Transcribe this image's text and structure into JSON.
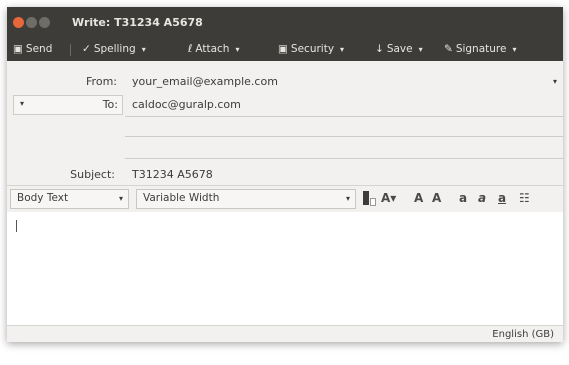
{
  "window": {
    "title": "Write: T31234  A5678"
  },
  "toolbar": {
    "send": "Send",
    "spelling": "Spelling",
    "attach": "Attach",
    "security": "Security",
    "save": "Save",
    "signature": "Signature"
  },
  "header": {
    "from_label": "From:",
    "from_value": "your_email@example.com",
    "to_label": "To:",
    "to_value": "caldoc@guralp.com",
    "subject_label": "Subject:",
    "subject_value": "T31234   A5678"
  },
  "format": {
    "paragraph_style": "Body Text",
    "font": "Variable Width"
  },
  "status": {
    "language": "English (GB)"
  }
}
